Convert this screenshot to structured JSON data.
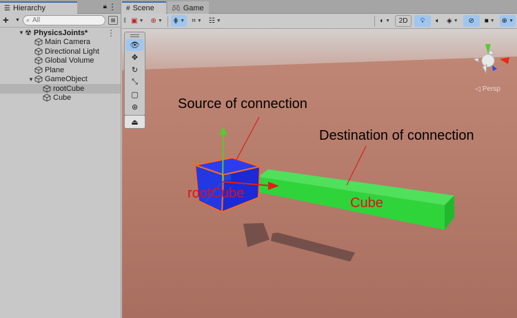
{
  "hierarchy": {
    "tab_label": "Hierarchy",
    "add_label": "+",
    "search_placeholder": "All",
    "root": "PhysicsJoints*",
    "items": [
      {
        "label": "Main Camera"
      },
      {
        "label": "Directional Light"
      },
      {
        "label": "Global Volume"
      },
      {
        "label": "Plane"
      },
      {
        "label": "GameObject"
      },
      {
        "label": "rootCube"
      },
      {
        "label": "Cube"
      }
    ]
  },
  "scene": {
    "tabs": [
      {
        "label": "Scene"
      },
      {
        "label": "Game"
      }
    ],
    "toolbar": {
      "mode_2d": "2D"
    },
    "persp_label": "◁ Persp",
    "annotations": {
      "source": "Source of connection",
      "destination": "Destination of connection",
      "root_cube": "rootCube",
      "cube": "Cube"
    }
  },
  "colors": {
    "sky": "#d8c8c6",
    "ground": "#b07565",
    "blue_cube": "#1b2fe8",
    "green_cube": "#2fd43b",
    "selection_outline": "#ff6a18",
    "annotation_red": "#e0101a",
    "active_button": "#9fc6ef"
  }
}
